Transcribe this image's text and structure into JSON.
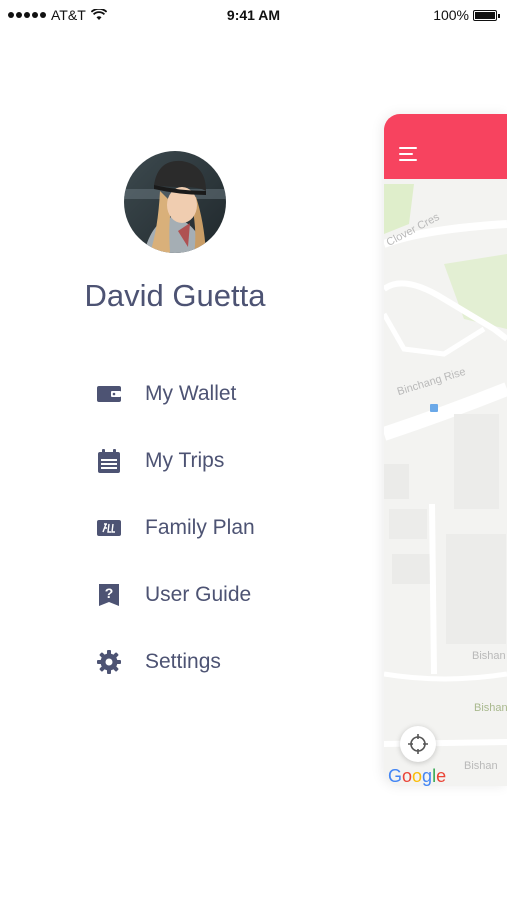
{
  "status_bar": {
    "carrier": "AT&T",
    "time": "9:41 AM",
    "battery": "100%"
  },
  "profile": {
    "name": "David Guetta"
  },
  "menu": {
    "items": [
      {
        "label": "My Wallet",
        "icon": "wallet-icon"
      },
      {
        "label": "My Trips",
        "icon": "calendar-icon"
      },
      {
        "label": "Family Plan",
        "icon": "family-plan-icon"
      },
      {
        "label": "User Guide",
        "icon": "guide-book-icon"
      },
      {
        "label": "Settings",
        "icon": "gear-icon"
      }
    ]
  },
  "map": {
    "road_labels": [
      "Clover Cres",
      "Binchang Rise",
      "Bishan",
      "Bishan",
      "Bishan"
    ],
    "attribution": "Google"
  },
  "colors": {
    "accent": "#f7435f",
    "text": "#4d5373",
    "icon": "#4d5373"
  }
}
